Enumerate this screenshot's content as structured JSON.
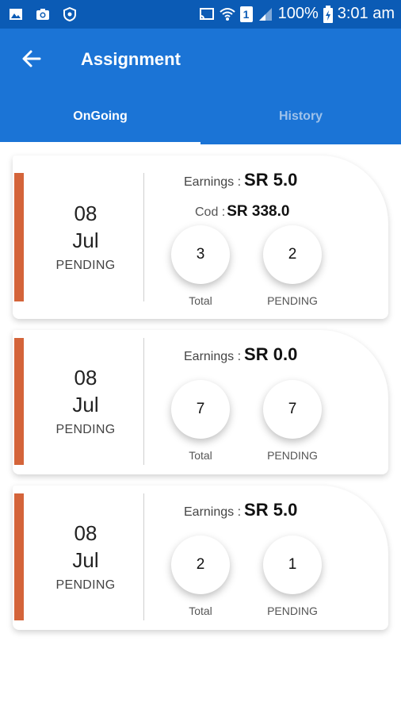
{
  "status_bar": {
    "battery": "100%",
    "time": "3:01 am",
    "sim": "1",
    "icons": [
      "image-icon",
      "camera-icon",
      "shield-icon",
      "cast-icon",
      "wifi-icon",
      "sim-icon",
      "signal-icon",
      "battery-icon"
    ]
  },
  "app_bar": {
    "title": "Assignment",
    "back_icon": "arrow-left-icon",
    "colors": {
      "primary": "#1b74d6",
      "status": "#0b5bb5",
      "accent_bar": "#d4643a"
    }
  },
  "tabs": [
    {
      "label": "OnGoing",
      "active": true
    },
    {
      "label": "History",
      "active": false
    }
  ],
  "cards": [
    {
      "day": "08",
      "month": "Jul",
      "status": "PENDING",
      "earnings_label": "Earnings :",
      "earnings_value": "SR 5.0",
      "cod_label": "Cod :",
      "cod_value": "SR 338.0",
      "total_count": "3",
      "total_label": "Total",
      "pending_count": "2",
      "pending_label": "PENDING"
    },
    {
      "day": "08",
      "month": "Jul",
      "status": "PENDING",
      "earnings_label": "Earnings :",
      "earnings_value": "SR 0.0",
      "total_count": "7",
      "total_label": "Total",
      "pending_count": "7",
      "pending_label": "PENDING"
    },
    {
      "day": "08",
      "month": "Jul",
      "status": "PENDING",
      "earnings_label": "Earnings :",
      "earnings_value": "SR 5.0",
      "total_count": "2",
      "total_label": "Total",
      "pending_count": "1",
      "pending_label": "PENDING"
    }
  ]
}
